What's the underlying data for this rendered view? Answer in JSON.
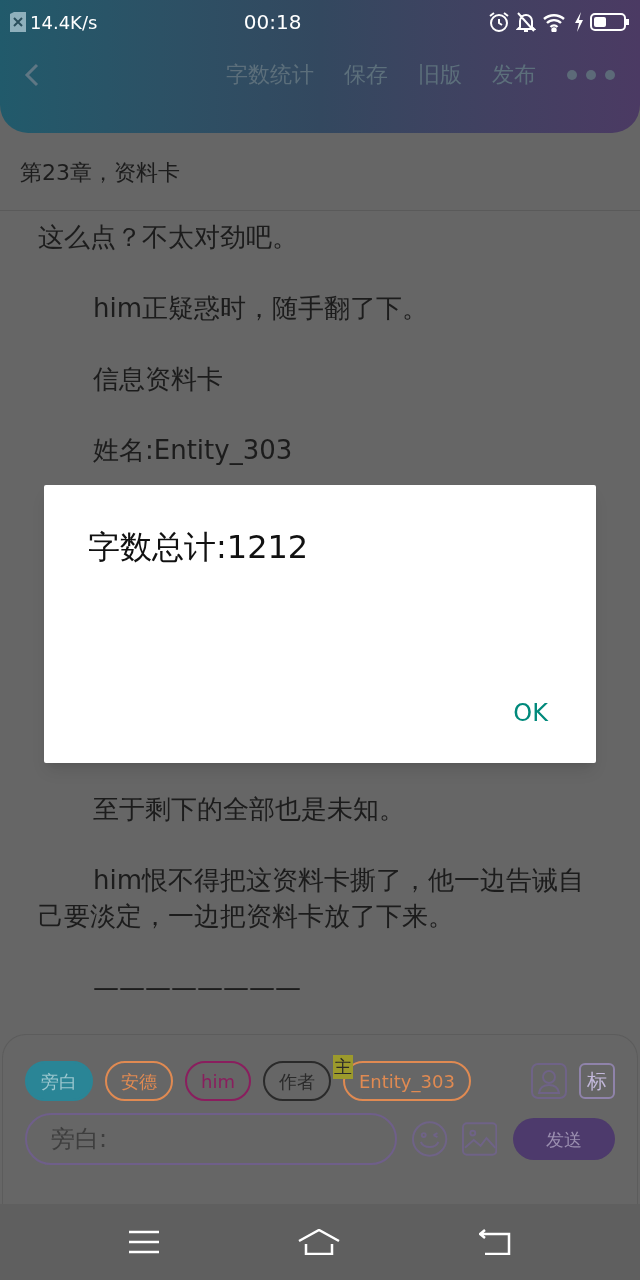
{
  "status_bar": {
    "speed": "14.4K/s",
    "time": "00:18"
  },
  "toolbar": {
    "actions": [
      "字数统计",
      "保存",
      "旧版",
      "发布"
    ]
  },
  "chapter_title": "第23章，资料卡",
  "paragraphs_above": [
    {
      "text": "这么点？不太对劲吧。",
      "indent": false
    },
    {
      "text": "him正疑惑时，随手翻了下。",
      "indent": true
    },
    {
      "text": "信息资料卡",
      "indent": true
    },
    {
      "text": "姓名:Entity_303",
      "indent": true
    }
  ],
  "paragraphs_below": [
    {
      "text": "至于剩下的全部也是未知。",
      "indent": true
    },
    {
      "text": "him恨不得把这资料卡撕了，他一边告诫自己要淡定，一边把资料卡放了下来。",
      "indent": true
    },
    {
      "text": "————————",
      "indent": true
    }
  ],
  "dialog": {
    "message": "字数总计:1212",
    "button": "OK"
  },
  "speakers": [
    {
      "label": "旁白",
      "selected": true,
      "color": "#2a8596"
    },
    {
      "label": "安德",
      "selected": false,
      "color": "#e08a52"
    },
    {
      "label": "him",
      "selected": false,
      "color": "#8a1e5e"
    },
    {
      "label": "作者",
      "selected": false,
      "color": "#2a2a2a"
    },
    {
      "label": "Entity_303",
      "selected": false,
      "color": "#e08a52",
      "badge": "主"
    }
  ],
  "tag_button": "标",
  "input": {
    "placeholder": "旁白:"
  },
  "send_button": "发送"
}
